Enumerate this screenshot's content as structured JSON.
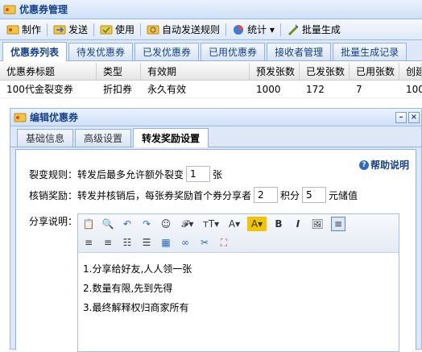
{
  "window": {
    "title": "优惠券管理"
  },
  "toolbar": {
    "items": [
      {
        "label": "制作",
        "icon": "make-icon"
      },
      {
        "label": "发送",
        "icon": "send-icon"
      },
      {
        "label": "使用",
        "icon": "use-icon"
      },
      {
        "label": "自动发送规则",
        "icon": "auto-send-icon"
      },
      {
        "label": "统计 ▾",
        "icon": "chart-icon"
      },
      {
        "label": "批量生成",
        "icon": "batch-icon"
      }
    ]
  },
  "tabs": [
    {
      "label": "优惠券列表",
      "active": true
    },
    {
      "label": "待发优惠券"
    },
    {
      "label": "已发优惠券"
    },
    {
      "label": "已用优惠券"
    },
    {
      "label": "接收者管理"
    },
    {
      "label": "批量生成记录"
    }
  ],
  "grid": {
    "columns": [
      "优惠券标题",
      "类型",
      "有效期",
      "预发张数",
      "已发张数",
      "已用张数",
      "创建"
    ],
    "rows": [
      [
        "100代金裂变券",
        "折扣券",
        "永久有效",
        "1000",
        "172",
        "7",
        "100"
      ]
    ]
  },
  "dialog": {
    "title": "编辑优惠券",
    "tabs": [
      {
        "label": "基础信息"
      },
      {
        "label": "高级设置"
      },
      {
        "label": "转发奖励设置",
        "active": true
      }
    ],
    "help_label": "帮助说明",
    "fission": {
      "label": "裂变规则：转发后最多允许额外裂变",
      "value": "1",
      "unit": "张"
    },
    "reward": {
      "label": "核销奖励：转发并核销后，每张券奖励首个券分享者",
      "points": "2",
      "points_unit": "积分",
      "value": "5",
      "value_unit": "元储值"
    },
    "share_label": "分享说明：",
    "editor_lines": [
      "1.分享给好友,人人领一张",
      "2.数量有限,先到先得",
      "3.最终解释权归商家所有"
    ],
    "minimize_symbol": "–",
    "close_symbol": "×"
  },
  "colors": {
    "accent": "#15428b",
    "header_bg": "#dfe8f6",
    "border": "#99bbe8"
  }
}
